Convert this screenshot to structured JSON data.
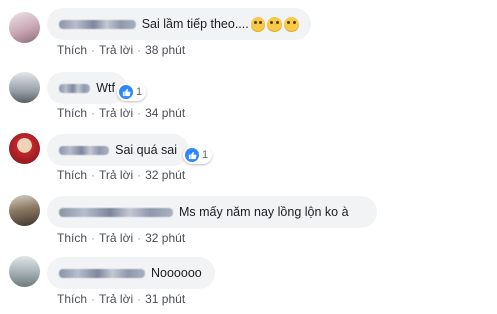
{
  "comments": [
    {
      "text": "Sai lầm tiếp theo....",
      "emojis": [
        "rolling-eyes-emoji",
        "rolling-eyes-emoji",
        "rolling-eyes-emoji"
      ],
      "reactions": "",
      "like": "Thích",
      "reply": "Trả lời",
      "time": "38 phút"
    },
    {
      "text": "Wtf",
      "emojis": [],
      "reactions": "1",
      "like": "Thích",
      "reply": "Trả lời",
      "time": "34 phút"
    },
    {
      "text": "Sai quá sai",
      "emojis": [],
      "reactions": "1",
      "like": "Thích",
      "reply": "Trả lời",
      "time": "32 phút"
    },
    {
      "text": "Ms mấy năm nay lồng lộn ko à",
      "emojis": [],
      "reactions": "",
      "like": "Thích",
      "reply": "Trả lời",
      "time": "32 phút"
    },
    {
      "text": "Noooooo",
      "emojis": [],
      "reactions": "",
      "like": "Thích",
      "reply": "Trả lời",
      "time": "31 phút"
    }
  ],
  "separator": "·",
  "colors": {
    "link": "#4b4f56",
    "bubble": "#f2f3f5",
    "like_blue": "#2d88ff"
  }
}
